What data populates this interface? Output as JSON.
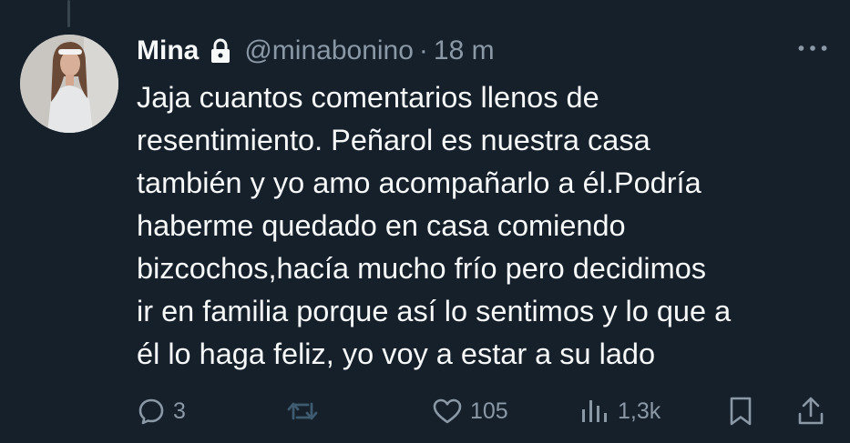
{
  "tweet": {
    "author_name": "Mina",
    "handle": "@minabonino",
    "separator": "·",
    "time": "18 m",
    "lines": [
      "Jaja cuantos comentarios llenos de",
      "resentimiento. Peñarol es nuestra casa",
      "también y yo amo acompañarlo a él.Podría",
      "haberme quedado en casa comiendo",
      "bizcochos,hacía mucho frío pero decidimos",
      "ir en familia porque así lo sentimos y lo que a",
      "él lo haga feliz, yo voy a estar a su lado"
    ]
  },
  "actions": {
    "replies": "3",
    "likes": "105",
    "views": "1,3k"
  },
  "icons": {
    "lock": "lock-icon",
    "more": "more-options-icon",
    "reply": "reply-icon",
    "retweet": "retweet-icon",
    "like": "heart-icon",
    "views": "views-icon",
    "bookmark": "bookmark-icon",
    "share": "share-icon"
  },
  "colors": {
    "background": "#15202b",
    "text": "#f7f9f9",
    "secondary": "#8b98a5",
    "retweet_disabled": "#3e5a6e"
  }
}
